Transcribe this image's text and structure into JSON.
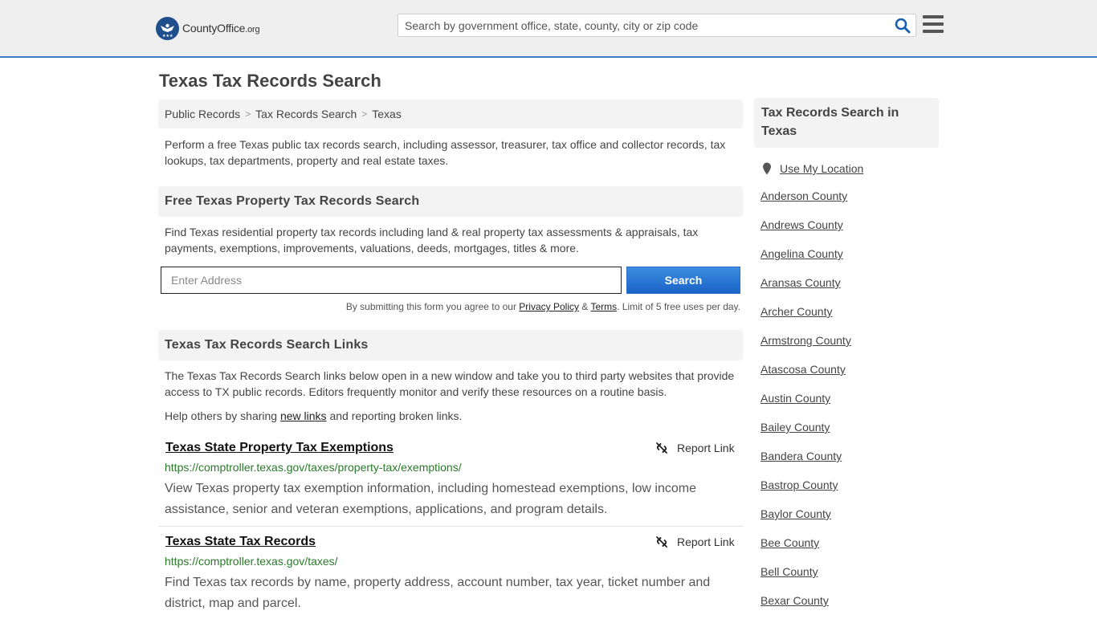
{
  "header": {
    "logo_name": "CountyOffice",
    "logo_tld": ".org",
    "search_placeholder": "Search by government office, state, county, city or zip code"
  },
  "page_title": "Texas Tax Records Search",
  "breadcrumb": [
    "Public Records",
    "Tax Records Search",
    "Texas"
  ],
  "intro": "Perform a free Texas public tax records search, including assessor, treasurer, tax office and collector records, tax lookups, tax departments, property and real estate taxes.",
  "property_search": {
    "heading": "Free Texas Property Tax Records Search",
    "text": "Find Texas residential property tax records including land & real property tax assessments & appraisals, tax payments, exemptions, improvements, valuations, deeds, mortgages, titles & more.",
    "address_placeholder": "Enter Address",
    "search_label": "Search",
    "disclaimer_prefix": "By submitting this form you agree to our",
    "privacy_label": "Privacy Policy",
    "amp": "&",
    "terms_label": "Terms",
    "disclaimer_suffix": ". Limit of 5 free uses per day."
  },
  "links_section": {
    "heading": "Texas Tax Records Search Links",
    "text": "The Texas Tax Records Search links below open in a new window and take you to third party websites that provide access to TX public records. Editors frequently monitor and verify these resources on a routine basis.",
    "help_prefix": "Help others by sharing",
    "help_link": "new links",
    "help_suffix": "and reporting broken links.",
    "report_label": "Report Link",
    "items": [
      {
        "title": "Texas State Property Tax Exemptions",
        "url": "https://comptroller.texas.gov/taxes/property-tax/exemptions/",
        "desc": "View Texas property tax exemption information, including homestead exemptions, low income assistance, senior and veteran exemptions, applications, and program details."
      },
      {
        "title": "Texas State Tax Records",
        "url": "https://comptroller.texas.gov/taxes/",
        "desc": "Find Texas tax records by name, property address, account number, tax year, ticket number and district, map and parcel."
      }
    ]
  },
  "sidebar": {
    "heading": "Tax Records Search in Texas",
    "location_label": "Use My Location",
    "counties": [
      "Anderson County",
      "Andrews County",
      "Angelina County",
      "Aransas County",
      "Archer County",
      "Armstrong County",
      "Atascosa County",
      "Austin County",
      "Bailey County",
      "Bandera County",
      "Bastrop County",
      "Baylor County",
      "Bee County",
      "Bell County",
      "Bexar County"
    ]
  },
  "colors": {
    "accent_blue": "#1a63c8",
    "url_green": "#2a7a2a",
    "header_bg": "#efefef"
  }
}
